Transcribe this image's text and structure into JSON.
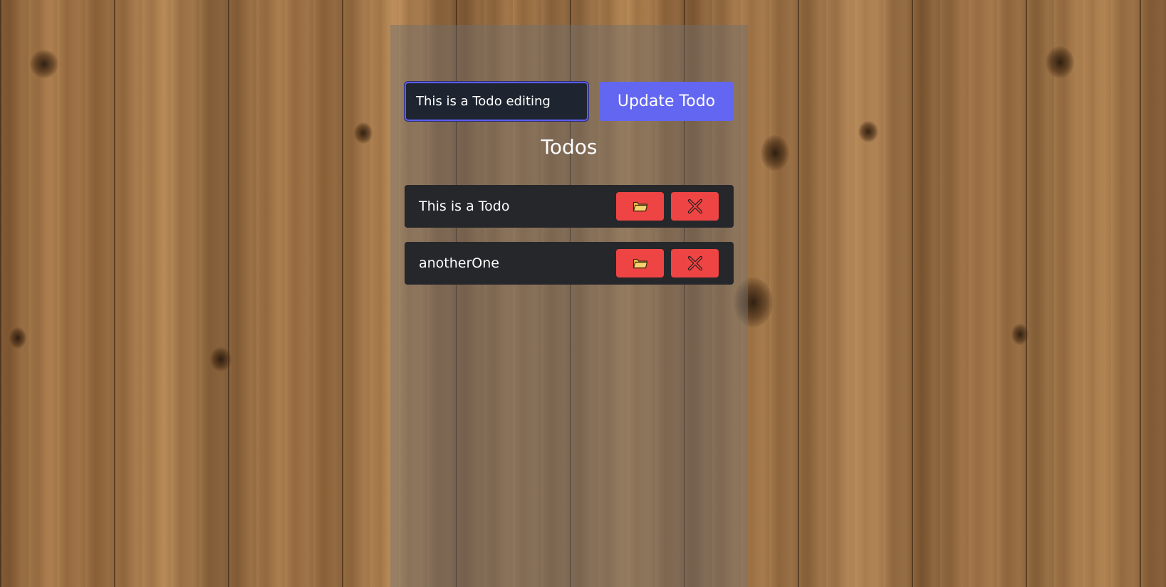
{
  "form": {
    "input_value": "This is a Todo editing",
    "submit_label": "Update Todo"
  },
  "list": {
    "heading": "Todos",
    "items": [
      {
        "text": "This is a Todo"
      },
      {
        "text": "anotherOne"
      }
    ]
  },
  "colors": {
    "accent": "#6366f1",
    "danger": "#ef4444",
    "item_bg": "#26272b",
    "input_bg": "#1f2530"
  },
  "icons": {
    "edit": "folder-icon",
    "delete": "close-icon"
  }
}
